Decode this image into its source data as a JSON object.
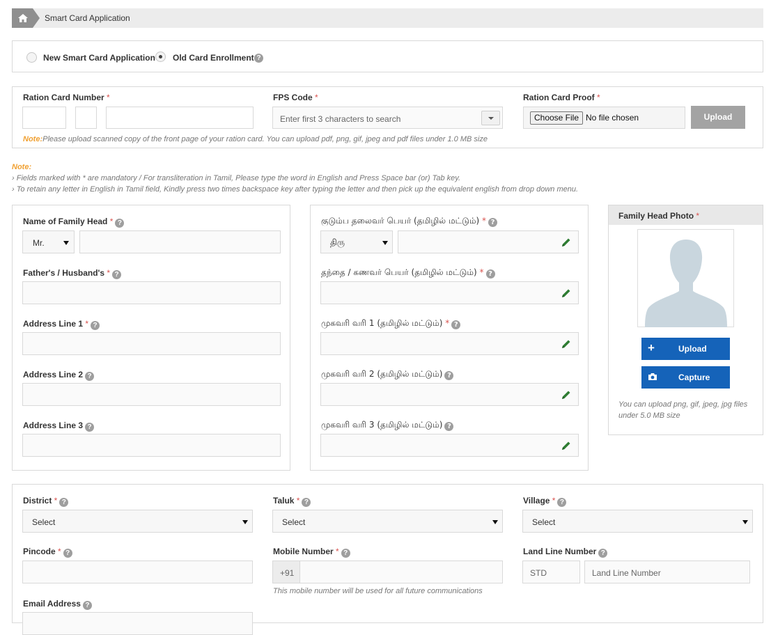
{
  "breadcrumb": {
    "home_icon": "home-icon",
    "current": "Smart Card Application"
  },
  "application_type": {
    "options": [
      {
        "label": "New Smart Card Application",
        "selected": false
      },
      {
        "label": "Old Card Enrollment",
        "selected": true
      }
    ]
  },
  "ration_card": {
    "number_label": "Ration Card Number",
    "fps_label": "FPS Code",
    "fps_placeholder": "Enter first 3 characters to search",
    "proof_label": "Ration Card Proof",
    "choose_file": "Choose File",
    "no_file": "No file chosen",
    "upload": "Upload",
    "note_label": "Note:",
    "note_text": "Please upload scanned copy of the front page of your ration card. You can upload pdf, png, gif, jpeg and pdf files under 1.0 MB size"
  },
  "notes": {
    "label": "Note:",
    "line1": "› Fields marked with  * are mandatory  / For transliteration in Tamil, Please type the word in English and Press Space bar (or) Tab key.",
    "line2": "› To retain any letter in English in Tamil field, Kindly press two times backspace key after typing the letter and then pick up the equivalent english from drop down menu."
  },
  "english_fields": {
    "family_head": "Name of Family Head",
    "title_value": "Mr.",
    "father": "Father's / Husband's",
    "addr1": "Address Line 1",
    "addr2": "Address Line 2",
    "addr3": "Address Line 3"
  },
  "tamil_fields": {
    "family_head": "குடும்ப தலைவர் பெயர் (தமிழில் மட்டும்)",
    "title_value": "திரு",
    "father": "தந்தை / கணவர் பெயர் (தமிழில் மட்டும்)",
    "addr1": "முகவரி வரி 1 (தமிழில் மட்டும்)",
    "addr2": "முகவரி வரி 2 (தமிழில் மட்டும்)",
    "addr3": "முகவரி வரி 3 (தமிழில் மட்டும்)"
  },
  "photo": {
    "title": "Family Head Photo",
    "upload": "Upload",
    "capture": "Capture",
    "note": "You can upload png, gif, jpeg, jpg files under 5.0 MB size"
  },
  "location": {
    "district": "District",
    "taluk": "Taluk",
    "village": "Village",
    "select": "Select",
    "pincode": "Pincode",
    "mobile": "Mobile Number",
    "mobile_prefix": "+91",
    "mobile_note": "This mobile number will be used for all future communications",
    "landline": "Land Line Number",
    "std_placeholder": "STD",
    "landline_placeholder": "Land Line Number",
    "email": "Email Address"
  },
  "colors": {
    "accent_blue": "#1563b9",
    "note_orange": "#f0a032",
    "required_red": "#d9534f",
    "pencil_green": "#2e7d32"
  }
}
